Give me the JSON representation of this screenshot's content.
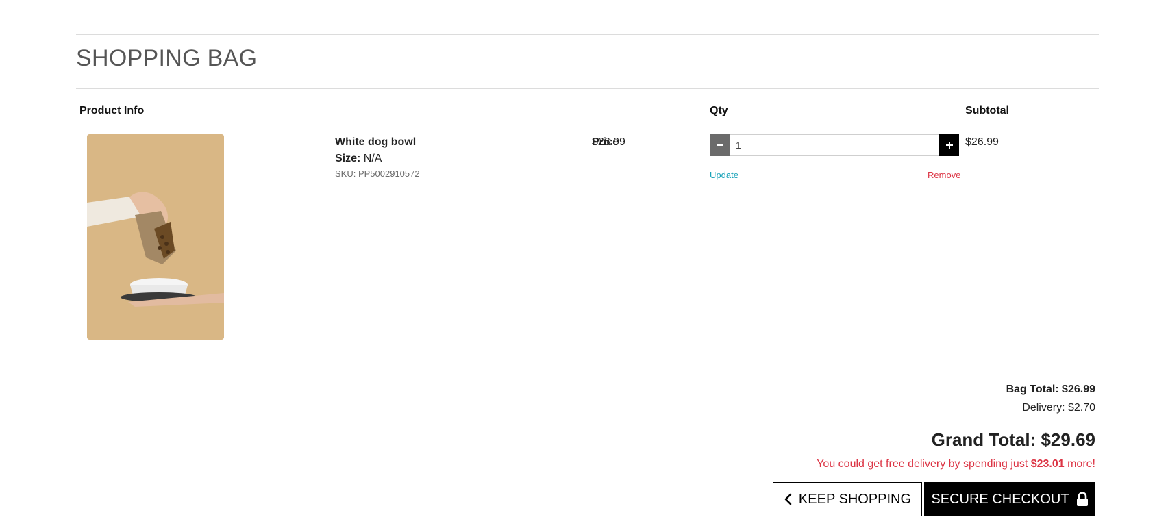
{
  "page": {
    "title": "SHOPPING BAG"
  },
  "table": {
    "headers": {
      "product_info": "Product Info",
      "price": "Price",
      "qty": "Qty",
      "subtotal": "Subtotal"
    }
  },
  "item": {
    "name": "White dog bowl",
    "size_label": "Size:",
    "size_value": "N/A",
    "sku": "SKU: PP5002910572",
    "price": "$26.99",
    "quantity": "1",
    "subtotal": "$26.99",
    "update_label": "Update",
    "remove_label": "Remove",
    "image_icon": "product-photo"
  },
  "summary": {
    "bag_total": "Bag Total: $26.99",
    "delivery": "Delivery: $2.70",
    "grand_total": "Grand Total: $29.69",
    "free_delivery_prefix": "You could get free delivery by spending just ",
    "free_delivery_amount": "$23.01",
    "free_delivery_suffix": " more!"
  },
  "actions": {
    "keep_shopping": "KEEP SHOPPING",
    "keep_shopping_icon": "chevron-left-icon",
    "secure_checkout": "SECURE CHECKOUT",
    "secure_checkout_icon": "lock-icon"
  },
  "colors": {
    "link_update": "#17a2b8",
    "link_remove": "#dc3545",
    "free_delivery_text": "#dc3545",
    "checkout_bg": "#000000",
    "qty_minus_bg": "#6b6b6b"
  }
}
